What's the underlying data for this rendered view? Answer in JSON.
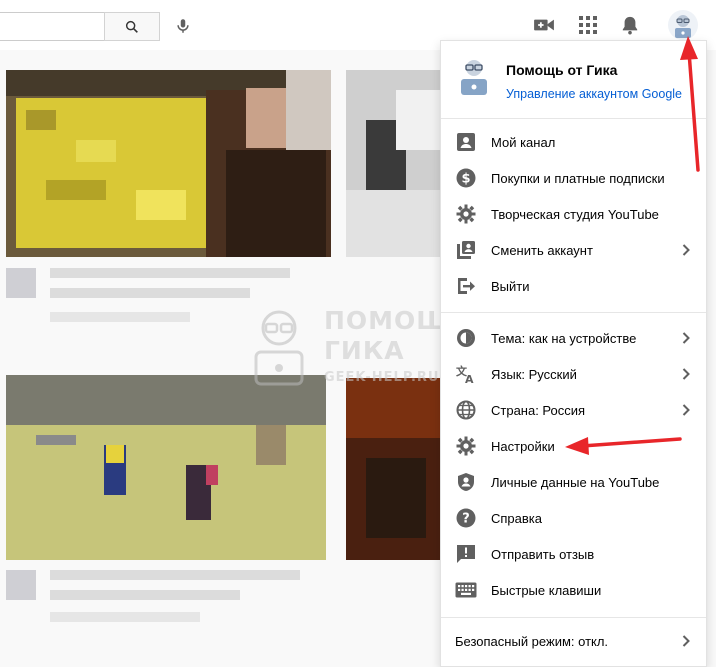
{
  "header": {
    "icons": [
      "search-icon",
      "mic-icon",
      "video-camera-icon",
      "apps-icon",
      "bell-icon",
      "avatar"
    ]
  },
  "watermark": {
    "line1": "ПОМОЩЬ",
    "line2": "ГИКА",
    "line3": "GEEK-HELP.RU"
  },
  "account": {
    "name": "Помощь от Гика",
    "manage_link": "Управление аккаунтом Google"
  },
  "menu": {
    "section1": [
      {
        "label": "Мой канал",
        "icon": "account-box-icon",
        "chevron": false
      },
      {
        "label": "Покупки и платные подписки",
        "icon": "dollar-icon",
        "chevron": false
      },
      {
        "label": "Творческая студия YouTube",
        "icon": "gear-icon",
        "chevron": false
      },
      {
        "label": "Сменить аккаунт",
        "icon": "switch-account-icon",
        "chevron": true
      },
      {
        "label": "Выйти",
        "icon": "logout-icon",
        "chevron": false
      }
    ],
    "section2": [
      {
        "label": "Тема: как на устройстве",
        "icon": "theme-icon",
        "chevron": true
      },
      {
        "label": "Язык: Русский",
        "icon": "translate-icon",
        "chevron": true
      },
      {
        "label": "Страна: Россия",
        "icon": "globe-icon",
        "chevron": true
      },
      {
        "label": "Настройки",
        "icon": "gear-icon",
        "chevron": false
      },
      {
        "label": "Личные данные на YouTube",
        "icon": "shield-person-icon",
        "chevron": false
      },
      {
        "label": "Справка",
        "icon": "help-icon",
        "chevron": false
      },
      {
        "label": "Отправить отзыв",
        "icon": "feedback-icon",
        "chevron": false
      },
      {
        "label": "Быстрые клавиши",
        "icon": "keyboard-icon",
        "chevron": false
      }
    ],
    "safe_mode": "Безопасный режим: откл."
  },
  "colors": {
    "link": "#065fd4",
    "annotation_arrow": "#e8262a",
    "icon": "#606060"
  }
}
